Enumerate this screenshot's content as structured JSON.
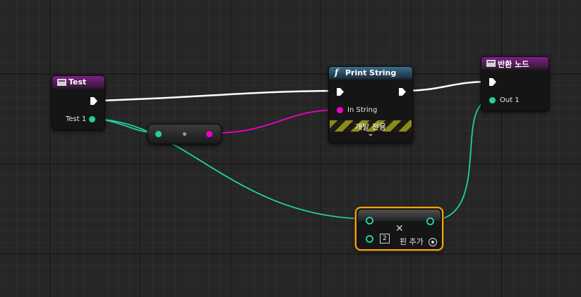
{
  "nodes": {
    "entry": {
      "title": "Test",
      "output_label": "Test 1"
    },
    "print_string": {
      "title": "Print String",
      "function_icon": "f",
      "input_label": "In String",
      "dev_only_label": "개발 전용",
      "expand_icon": "⌄"
    },
    "return": {
      "title": "반환 노드",
      "output_label": "Out 1"
    },
    "make_array": {
      "count": "2",
      "remove_icon": "✕",
      "add_pin_label": "핀 추가"
    }
  },
  "icons": {
    "event": "event-icon",
    "function": "function-icon",
    "exec_pin": "exec-pin-icon",
    "data_pin": "data-pin-icon",
    "add": "add-pin-icon",
    "remove": "remove-pin-icon"
  },
  "colors": {
    "background": "#262626",
    "exec_wire": "#ffffff",
    "teal_pin": "#1fd0a4",
    "string_pin": "#f000c8",
    "event_header": "#7e1f86",
    "function_header": "#3a6d8c",
    "selection": "#e8a416"
  }
}
